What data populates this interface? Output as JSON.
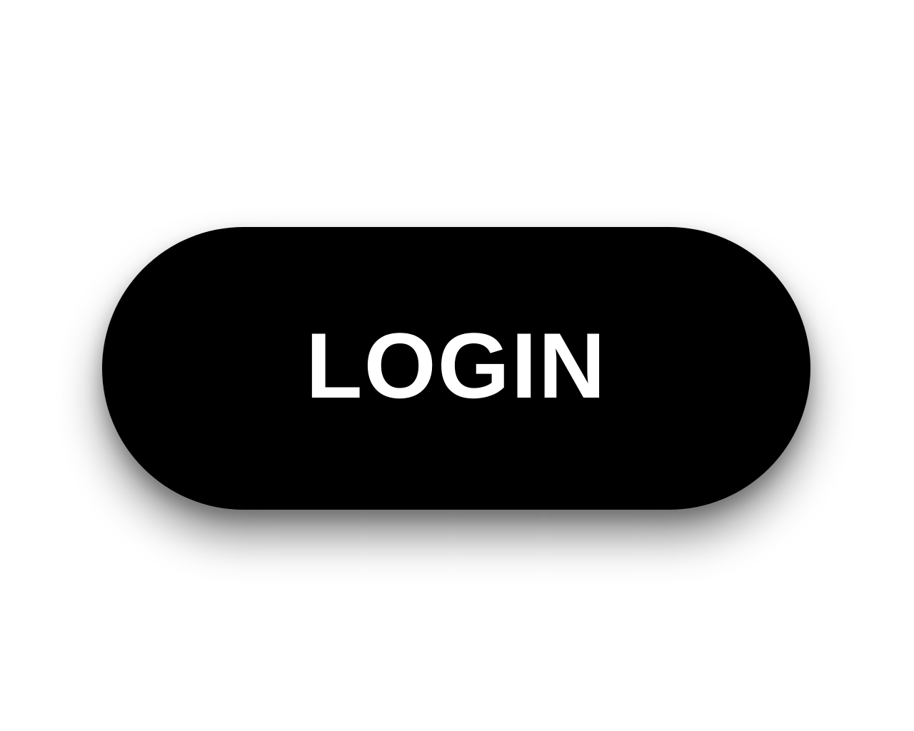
{
  "login_button": {
    "label": "LOGIN"
  },
  "colors": {
    "background": "#ffffff",
    "button_background": "#000000",
    "button_text": "#ffffff"
  }
}
